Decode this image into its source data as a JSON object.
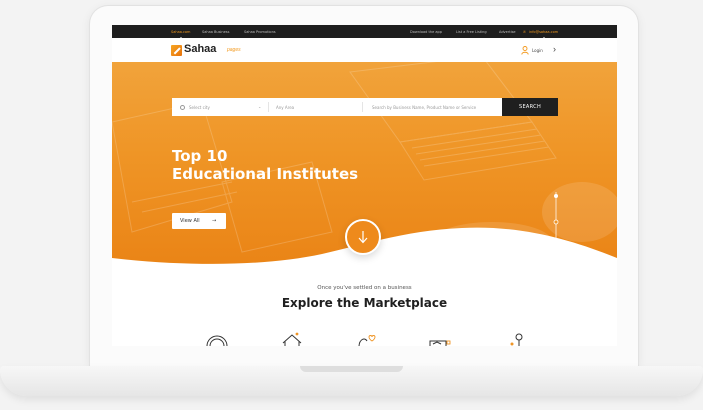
{
  "topbar": {
    "links": [
      "Sahaa.com",
      "Sahaa Business",
      "Sahaa Promotions"
    ],
    "right_links": [
      "Download the app",
      "List a Free Listing",
      "Advertise"
    ],
    "email": "info@sahaa.com"
  },
  "nav": {
    "logo_text": "Sahaa",
    "logo_suffix": "pages",
    "login_label": "Login",
    "arrow": "›"
  },
  "search": {
    "city_placeholder": "Select city",
    "area_placeholder": "Any Area",
    "query_placeholder": "Search by Business Name, Product Name or Service",
    "button_label": "SEARCH"
  },
  "hero": {
    "title_line1": "Top 10",
    "title_line2": "Educational Institutes",
    "view_all_label": "View All",
    "view_all_arrow": "→"
  },
  "explore": {
    "tagline": "Once you've settled on a business",
    "title": "Explore the Marketplace"
  },
  "colors": {
    "brand_orange": "#ef9526",
    "dark": "#1f1f1f"
  },
  "icons": [
    "chevron-down-icon",
    "user-icon",
    "arrow-down-icon",
    "location-icon"
  ]
}
